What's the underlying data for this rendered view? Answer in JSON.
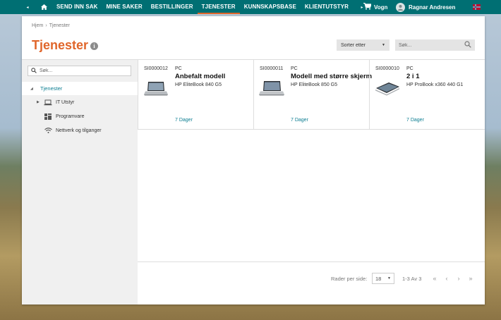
{
  "nav": {
    "prev_arrow": "◂",
    "next_arrow": "▸",
    "items": [
      {
        "label": "SEND INN SAK"
      },
      {
        "label": "MINE SAKER"
      },
      {
        "label": "BESTILLINGER"
      },
      {
        "label": "TJENESTER",
        "active": true
      },
      {
        "label": "KUNNSKAPSBASE"
      },
      {
        "label": "KLIENTUTSTYR"
      }
    ],
    "cart_label": "Vogn",
    "user_name": "Ragnar Andresen",
    "accent_color": "#006f73",
    "active_underline_color": "#e0662b"
  },
  "breadcrumb": {
    "home": "Hjem",
    "current": "Tjenester"
  },
  "page": {
    "title": "Tjenester",
    "info_icon": "i"
  },
  "sort": {
    "label": "Sorter etter"
  },
  "top_search": {
    "placeholder": "Søk..."
  },
  "sidebar": {
    "search_placeholder": "Søk...",
    "root": {
      "label": "Tjenester"
    },
    "items": [
      {
        "label": "IT Utstyr",
        "icon": "laptop-icon",
        "expandable": true
      },
      {
        "label": "Programvare",
        "icon": "software-icon",
        "expandable": false
      },
      {
        "label": "Nettverk og tilganger",
        "icon": "wifi-icon",
        "expandable": false
      }
    ]
  },
  "cards": [
    {
      "id": "SI0000012",
      "category": "PC",
      "title": "Anbefalt modell",
      "model": "HP EliteBook 840 G5",
      "duration": "7 Dager"
    },
    {
      "id": "SI0000011",
      "category": "PC",
      "title": "Modell med større skjerm",
      "model": "HP EliteBook 850 G5",
      "duration": "7 Dager"
    },
    {
      "id": "SI0000010",
      "category": "PC",
      "title": "2 i 1",
      "model": "HP ProBook x360 440 G1",
      "duration": "7 Dager"
    }
  ],
  "footer": {
    "rows_label": "Rader per side:",
    "rows_value": "18",
    "range": "1-3 Av 3",
    "first": "«",
    "prev": "‹",
    "next": "›",
    "last": "»"
  }
}
